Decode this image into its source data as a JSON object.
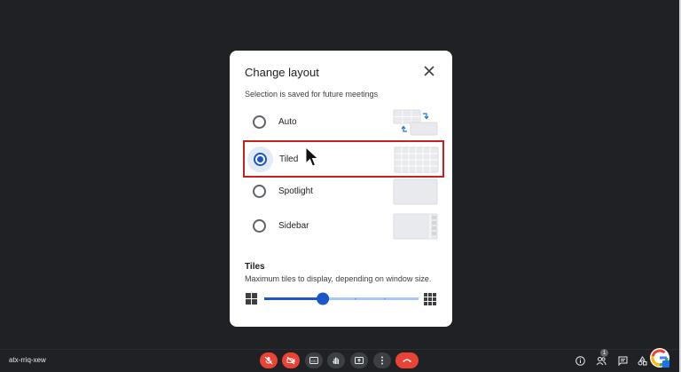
{
  "dialog": {
    "title": "Change layout",
    "subtitle": "Selection is saved for future meetings",
    "options": [
      {
        "label": "Auto",
        "selected": false,
        "thumb": "auto-layout-icon"
      },
      {
        "label": "Tiled",
        "selected": true,
        "thumb": "tiled-layout-icon"
      },
      {
        "label": "Spotlight",
        "selected": false,
        "thumb": "spotlight-layout-icon"
      },
      {
        "label": "Sidebar",
        "selected": false,
        "thumb": "sidebar-layout-icon"
      }
    ],
    "tiles": {
      "heading": "Tiles",
      "description": "Maximum tiles to display, depending on window size.",
      "slider_value_fraction": 0.38
    }
  },
  "meeting": {
    "code": "atx-rriq-xew",
    "participants_badge": "1"
  },
  "colors": {
    "accent": "#1a56c8",
    "highlight_border": "#c5221f",
    "end_call": "#ea4335",
    "stage_bg": "#202124"
  }
}
